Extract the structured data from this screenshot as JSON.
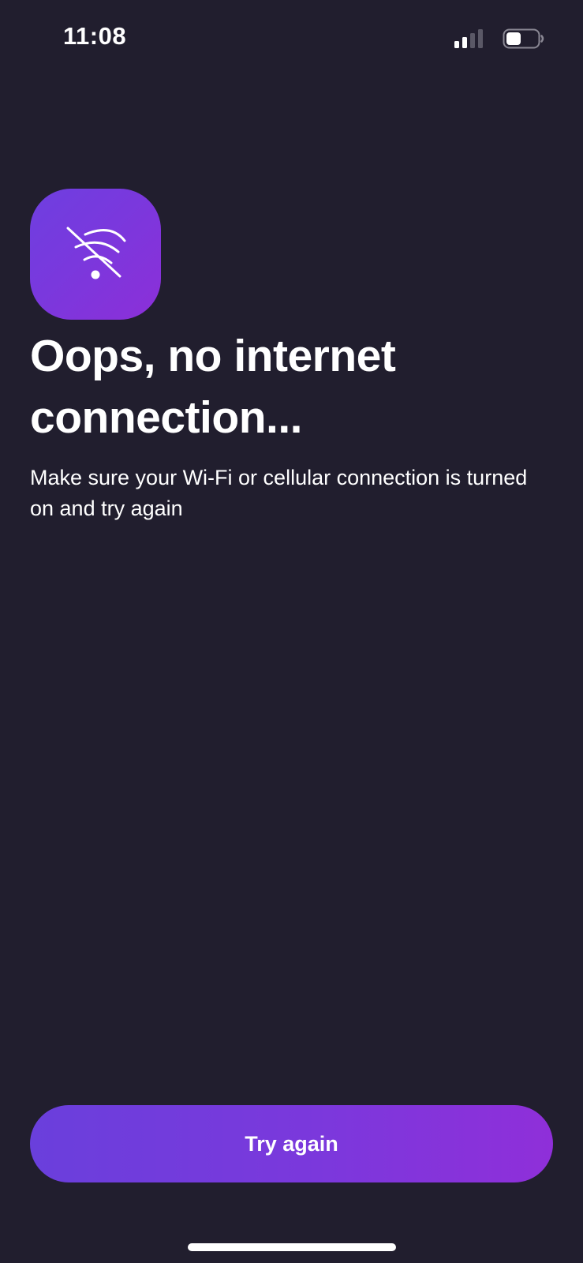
{
  "status_bar": {
    "time": "11:08",
    "signal_icon": "cellular-signal-icon",
    "battery_icon": "battery-icon"
  },
  "error": {
    "icon": "wifi-off-icon",
    "title": "Oops, no internet connection...",
    "message": "Make sure your Wi-Fi or cellular connection is turned on and try again"
  },
  "actions": {
    "try_again_label": "Try again"
  },
  "colors": {
    "background": "#211e2e",
    "accent_start": "#6a3fdc",
    "accent_end": "#8f2fd9",
    "text": "#ffffff"
  }
}
